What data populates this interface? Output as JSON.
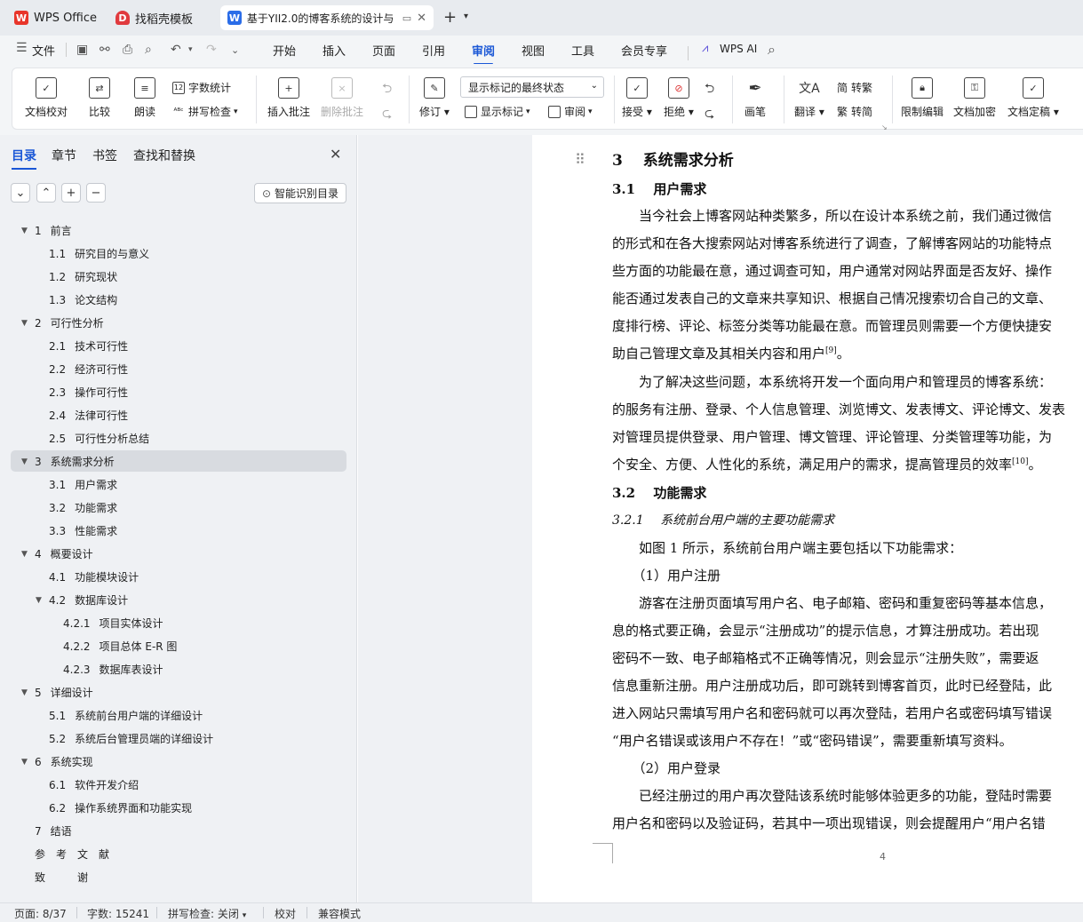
{
  "tabs": [
    {
      "label": "WPS Office",
      "icon": "wps-logo-icon"
    },
    {
      "label": "找稻壳模板",
      "icon": "docer-logo-icon"
    },
    {
      "label": "基于YII2.0的博客系统的设计与",
      "icon": "word-doc-icon"
    }
  ],
  "menu": {
    "file": "文件",
    "items": [
      "开始",
      "插入",
      "页面",
      "引用",
      "审阅",
      "视图",
      "工具",
      "会员专享"
    ],
    "active": "审阅",
    "ai": "WPS AI"
  },
  "ribbon": {
    "doc_proof": "文档校对",
    "compare": "比较",
    "read_aloud": "朗读",
    "word_count": "字数统计",
    "spell_check": "拼写检查",
    "insert_comment": "插入批注",
    "delete_comment": "删除批注",
    "revise": "修订",
    "markup_state": "显示标记的最终状态",
    "show_markup": "显示标记",
    "review_pane": "审阅",
    "accept": "接受",
    "reject": "拒绝",
    "pen": "画笔",
    "translate": "翻译",
    "to_traditional": "转繁",
    "to_simplified": "转简",
    "restrict_edit": "限制编辑",
    "encrypt": "文档加密",
    "finalize": "文档定稿",
    "simp_glyph": "简",
    "trad_glyph": "繁",
    "count_glyph": "12"
  },
  "panel": {
    "tabs": [
      "目录",
      "章节",
      "书签",
      "查找和替换"
    ],
    "smart_toc": "智能识别目录",
    "toc": [
      {
        "num": "1",
        "text": "前言",
        "level": 1,
        "caret": "▼"
      },
      {
        "num": "1.1",
        "text": "研究目的与意义",
        "level": 2
      },
      {
        "num": "1.2",
        "text": "研究现状",
        "level": 2
      },
      {
        "num": "1.3",
        "text": "论文结构",
        "level": 2
      },
      {
        "num": "2",
        "text": "可行性分析",
        "level": 1,
        "caret": "▼"
      },
      {
        "num": "2.1",
        "text": "技术可行性",
        "level": 2
      },
      {
        "num": "2.2",
        "text": "经济可行性",
        "level": 2
      },
      {
        "num": "2.3",
        "text": "操作可行性",
        "level": 2
      },
      {
        "num": "2.4",
        "text": "法律可行性",
        "level": 2
      },
      {
        "num": "2.5",
        "text": "可行性分析总结",
        "level": 2
      },
      {
        "num": "3",
        "text": "系统需求分析",
        "level": 1,
        "caret": "▼",
        "selected": true
      },
      {
        "num": "3.1",
        "text": "用户需求",
        "level": 2
      },
      {
        "num": "3.2",
        "text": "功能需求",
        "level": 2
      },
      {
        "num": "3.3",
        "text": "性能需求",
        "level": 2
      },
      {
        "num": "4",
        "text": "概要设计",
        "level": 1,
        "caret": "▼"
      },
      {
        "num": "4.1",
        "text": "功能模块设计",
        "level": 2
      },
      {
        "num": "4.2",
        "text": "数据库设计",
        "level": 2,
        "caret": "▼"
      },
      {
        "num": "4.2.1",
        "text": "项目实体设计",
        "level": 3
      },
      {
        "num": "4.2.2",
        "text": "项目总体 E-R 图",
        "level": 3
      },
      {
        "num": "4.2.3",
        "text": "数据库表设计",
        "level": 3
      },
      {
        "num": "5",
        "text": "详细设计",
        "level": 1,
        "caret": "▼"
      },
      {
        "num": "5.1",
        "text": "系统前台用户端的详细设计",
        "level": 2
      },
      {
        "num": "5.2",
        "text": "系统后台管理员端的详细设计",
        "level": 2
      },
      {
        "num": "6",
        "text": "系统实现",
        "level": 1,
        "caret": "▼"
      },
      {
        "num": "6.1",
        "text": "软件开发介绍",
        "level": 2
      },
      {
        "num": "6.2",
        "text": "操作系统界面和功能实现",
        "level": 2
      },
      {
        "num": "7",
        "text": "结语",
        "level": 1
      },
      {
        "num": "",
        "text": "参　考　文　献",
        "level": 1
      },
      {
        "num": "",
        "text": "致　　　谢",
        "level": 1
      }
    ]
  },
  "doc": {
    "h1_num": "3",
    "h1": "系统需求分析",
    "s31_num": "3.1",
    "s31": "用户需求",
    "p1": [
      "　　当今社会上博客网站种类繁多，所以在设计本系统之前，我们通过微信",
      "的形式和在各大搜索网站对博客系统进行了调查，了解博客网站的功能特点",
      "些方面的功能最在意，通过调查可知，用户通常对网站界面是否友好、操作",
      "能否通过发表自己的文章来共享知识、根据自己情况搜索切合自己的文章、",
      "度排行榜、评论、标签分类等功能最在意。而管理员则需要一个方便快捷安",
      "助自己管理文章及其相关内容和用户"
    ],
    "ref9": "[9]",
    "p1_end": "。",
    "p2": [
      "　　为了解决这些问题，本系统将开发一个面向用户和管理员的博客系统：",
      "的服务有注册、登录、个人信息管理、浏览博文、发表博文、评论博文、发表",
      "对管理员提供登录、用户管理、博文管理、评论管理、分类管理等功能，为",
      "个安全、方便、人性化的系统，满足用户的需求，提高管理员的效率"
    ],
    "ref10": "[10]",
    "p2_end": "。",
    "s32_num": "3.2",
    "s32": "功能需求",
    "s321_num": "3.2.1",
    "s321": "系统前台用户端的主要功能需求",
    "p3": "　　如图 1 所示，系统前台用户端主要包括以下功能需求：",
    "item1": "　　（1）用户注册",
    "p4": [
      "　　游客在注册页面填写用户名、电子邮箱、密码和重复密码等基本信息，",
      "息的格式要正确，会显示“注册成功”的提示信息，才算注册成功。若出现",
      "密码不一致、电子邮箱格式不正确等情况，则会显示“注册失败”，需要返",
      "信息重新注册。用户注册成功后，即可跳转到博客首页，此时已经登陆，此",
      "进入网站只需填写用户名和密码就可以再次登陆，若用户名或密码填写错误",
      "“用户名错误或该用户不存在！”或“密码错误”，需要重新填写资料。"
    ],
    "item2": "　　（2）用户登录",
    "p5": [
      "　　已经注册过的用户再次登陆该系统时能够体验更多的功能，登陆时需要",
      "用户名和密码以及验证码，若其中一项出现错误，则会提醒用户“用户名错"
    ],
    "page_num": "4"
  },
  "status": {
    "page": "页面: 8/37",
    "words": "字数: 15241",
    "spell": "拼写检查: 关闭",
    "proof": "校对",
    "compat": "兼容模式"
  },
  "colors": {
    "accent": "#1a57d6",
    "wps_red": "#e8352a",
    "docer_red": "#e03a3e",
    "doc_blue": "#2b6de8"
  }
}
